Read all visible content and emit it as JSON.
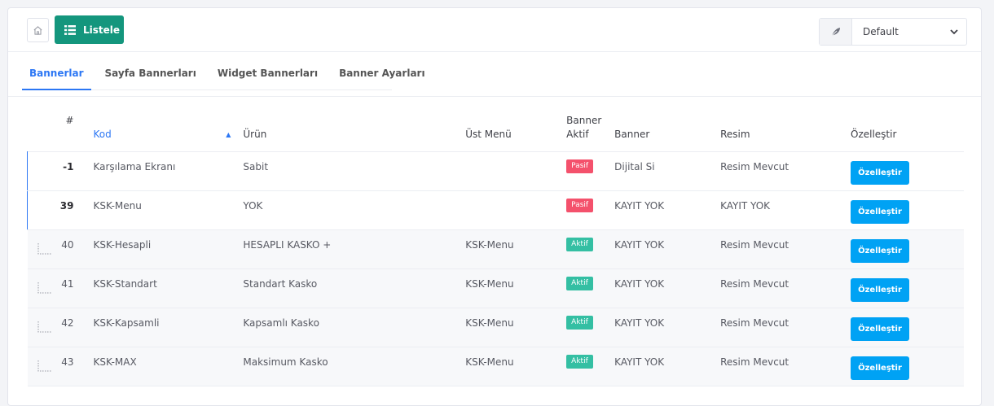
{
  "toolbar": {
    "list_label": "Listele",
    "theme_value": "Default"
  },
  "tabs": [
    {
      "label": "Bannerlar",
      "active": true
    },
    {
      "label": "Sayfa Bannerları",
      "active": false
    },
    {
      "label": "Widget Bannerları",
      "active": false
    },
    {
      "label": "Banner Ayarları",
      "active": false
    }
  ],
  "table": {
    "headers": {
      "id": "#",
      "kod": "Kod",
      "urun": "Ürün",
      "ust_menu": "Üst Menü",
      "banner_aktif_1": "Banner",
      "banner_aktif_2": "Aktif",
      "banner": "Banner",
      "resim": "Resim",
      "ozellestir": "Özelleştir"
    },
    "rows": [
      {
        "id": "-1",
        "kod": "Karşılama Ekranı",
        "urun": "Sabit",
        "ust_menu": "",
        "aktif": "Pasif",
        "banner": "Dijital Si",
        "resim": "Resim Mevcut",
        "action": "Özelleştir"
      },
      {
        "id": "39",
        "kod": "KSK-Menu",
        "urun": "YOK",
        "ust_menu": "",
        "aktif": "Pasif",
        "banner": "KAYIT YOK",
        "resim": "KAYIT YOK",
        "action": "Özelleştir"
      },
      {
        "id": "40",
        "kod": "KSK-Hesapli",
        "urun": "HESAPLI KASKO +",
        "ust_menu": "KSK-Menu",
        "aktif": "Aktif",
        "banner": "KAYIT YOK",
        "resim": "Resim Mevcut",
        "action": "Özelleştir"
      },
      {
        "id": "41",
        "kod": "KSK-Standart",
        "urun": "Standart Kasko",
        "ust_menu": "KSK-Menu",
        "aktif": "Aktif",
        "banner": "KAYIT YOK",
        "resim": "Resim Mevcut",
        "action": "Özelleştir"
      },
      {
        "id": "42",
        "kod": "KSK-Kapsamli",
        "urun": "Kapsamlı Kasko",
        "ust_menu": "KSK-Menu",
        "aktif": "Aktif",
        "banner": "KAYIT YOK",
        "resim": "Resim Mevcut",
        "action": "Özelleştir"
      },
      {
        "id": "43",
        "kod": "KSK-MAX",
        "urun": "Maksimum Kasko",
        "ust_menu": "KSK-Menu",
        "aktif": "Aktif",
        "banner": "KAYIT YOK",
        "resim": "Resim Mevcut",
        "action": "Özelleştir"
      }
    ]
  },
  "colors": {
    "primary": "#14967d",
    "accent": "#2c77f4",
    "action": "#00a2f4",
    "pasif": "#f4516c",
    "aktif": "#34bfa3"
  }
}
